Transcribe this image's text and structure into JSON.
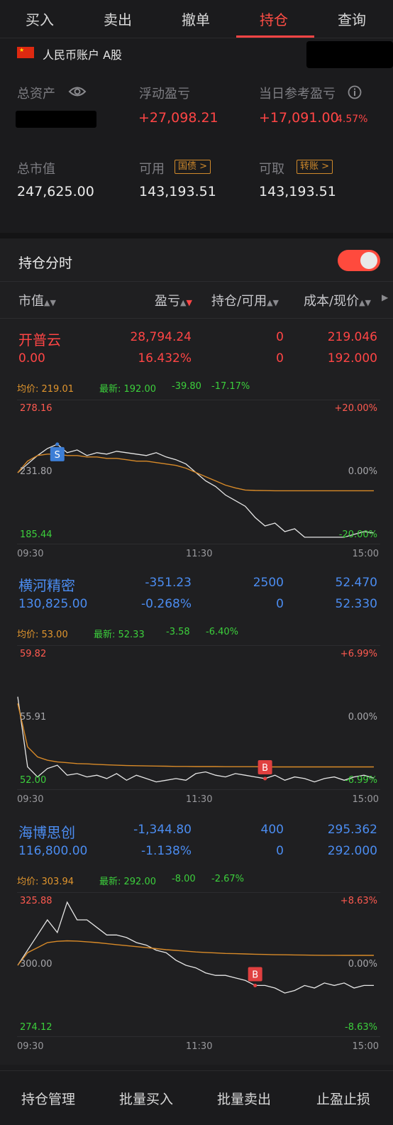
{
  "tabs": [
    "买入",
    "卖出",
    "撤单",
    "持仓",
    "查询"
  ],
  "account": {
    "title": "人民币账户 A股",
    "flag_icon": "china-flag-icon",
    "total_assets_label": "总资产",
    "float_pl_label": "浮动盈亏",
    "float_pl_value": "+27,098.21",
    "daily_pl_label": "当日参考盈亏",
    "daily_pl_value": "+17,091.00",
    "daily_pl_pct": "4.57%",
    "market_value_label": "总市值",
    "market_value": "247,625.00",
    "available_label": "可用",
    "available_tag": "国债 >",
    "available_value": "143,193.51",
    "withdrawable_label": "可取",
    "withdrawable_tag": "转账 >",
    "withdrawable_value": "143,193.51"
  },
  "positions_section": {
    "title": "持仓分时",
    "toggle_on": true
  },
  "columns": {
    "c1": "市值",
    "c2": "盈亏",
    "c3": "持仓/可用",
    "c4": "成本/现价"
  },
  "time_labels": {
    "start": "09:30",
    "mid": "11:30",
    "end": "15:00"
  },
  "stocks": [
    {
      "name": "开普云",
      "pl": "28,794.24",
      "holding": "0",
      "cost": "219.046",
      "market_value": "0.00",
      "pl_pct": "16.432%",
      "available": "0",
      "price": "192.000",
      "avg_label": "均价: 219.01",
      "latest_label": "最新: 192.00",
      "change": "-39.80",
      "change_pct": "-17.17%",
      "axis_top": "278.16",
      "axis_mid": "231.80",
      "axis_bot": "185.44",
      "pct_top": "+20.00%",
      "pct_mid": "0.00%",
      "pct_bot": "-20.00%",
      "marker": "S",
      "chart_data": {
        "type": "line",
        "ylim": [
          185.44,
          278.16
        ],
        "series": [
          {
            "values": [
              231.8,
              238,
              244,
              249,
              252,
              246,
              248,
              244,
              246,
              245,
              247,
              246,
              245,
              244,
              246,
              243,
              241,
              238,
              232,
              226,
              222,
              216,
              212,
              208,
              200,
              194,
              196,
              190,
              192,
              186,
              186,
              186,
              186,
              186,
              188,
              190,
              189
            ]
          },
          {
            "values": [
              231.8,
              240,
              244,
              245,
              245,
              244,
              244,
              243,
              243,
              242,
              242,
              241,
              240,
              240,
              239,
              238,
              237,
              235,
              232,
              229,
              226,
              223,
              221,
              219.5,
              219.2,
              219.1,
              219.0,
              219.0,
              219.0,
              219.0,
              219.0,
              219.0,
              219.0,
              219.0,
              219.0,
              219.0,
              219.01
            ]
          }
        ]
      }
    },
    {
      "name": "横河精密",
      "pl": "-351.23",
      "holding": "2500",
      "cost": "52.470",
      "market_value": "130,825.00",
      "pl_pct": "-0.268%",
      "available": "0",
      "price": "52.330",
      "avg_label": "均价: 53.00",
      "latest_label": "最新: 52.33",
      "change": "-3.58",
      "change_pct": "-6.40%",
      "axis_top": "59.82",
      "axis_mid": "55.91",
      "axis_bot": "52.00",
      "pct_top": "+6.99%",
      "pct_mid": "0.00%",
      "pct_bot": "-6.99%",
      "marker": "B",
      "chart_data": {
        "type": "line",
        "ylim": [
          52.0,
          59.82
        ],
        "series": [
          {
            "values": [
              57.2,
              53.0,
              52.4,
              52.9,
              53.1,
              52.5,
              52.6,
              52.4,
              52.5,
              52.3,
              52.6,
              52.2,
              52.5,
              52.3,
              52.1,
              52.2,
              52.3,
              52.2,
              52.6,
              52.7,
              52.5,
              52.4,
              52.6,
              52.5,
              52.4,
              52.3,
              52.5,
              52.2,
              52.4,
              52.3,
              52.1,
              52.3,
              52.4,
              52.2,
              52.4,
              52.5,
              52.33
            ]
          },
          {
            "values": [
              56.8,
              54.2,
              53.6,
              53.4,
              53.3,
              53.25,
              53.2,
              53.18,
              53.15,
              53.12,
              53.1,
              53.08,
              53.07,
              53.06,
              53.05,
              53.04,
              53.03,
              53.03,
              53.02,
              53.02,
              53.02,
              53.01,
              53.01,
              53.01,
              53.01,
              53.0,
              53.0,
              53.0,
              53.0,
              53.0,
              53.0,
              53.0,
              53.0,
              53.0,
              53.0,
              53.0,
              53.0
            ]
          }
        ]
      }
    },
    {
      "name": "海博思创",
      "pl": "-1,344.80",
      "holding": "400",
      "cost": "295.362",
      "market_value": "116,800.00",
      "pl_pct": "-1.138%",
      "available": "0",
      "price": "292.000",
      "avg_label": "均价: 303.94",
      "latest_label": "最新: 292.00",
      "change": "-8.00",
      "change_pct": "-2.67%",
      "axis_top": "325.88",
      "axis_mid": "300.00",
      "axis_bot": "274.12",
      "pct_top": "+8.63%",
      "pct_mid": "0.00%",
      "pct_bot": "-8.63%",
      "marker": "B",
      "chart_data": {
        "type": "line",
        "ylim": [
          274.12,
          325.88
        ],
        "series": [
          {
            "values": [
              300,
              306,
              312,
              318,
              313,
              325,
              318,
              318,
              315,
              312,
              312,
              311,
              309,
              308,
              306,
              305,
              302,
              300,
              299,
              297,
              296,
              296,
              295,
              294,
              292,
              292,
              291,
              289,
              290,
              292,
              291,
              293,
              292,
              293,
              291,
              292,
              292
            ]
          },
          {
            "values": [
              300,
              305,
              307,
              309,
              309.5,
              309.7,
              309.6,
              309.3,
              309,
              308.6,
              308.2,
              307.8,
              307.4,
              307,
              306.6,
              306.2,
              305.9,
              305.6,
              305.3,
              305.1,
              304.9,
              304.7,
              304.6,
              304.5,
              304.4,
              304.3,
              304.2,
              304.15,
              304.1,
              304.05,
              304,
              303.98,
              303.96,
              303.95,
              303.94,
              303.94,
              303.94
            ]
          }
        ]
      }
    }
  ],
  "bottom_bar": [
    "持仓管理",
    "批量买入",
    "批量卖出",
    "止盈止损"
  ]
}
